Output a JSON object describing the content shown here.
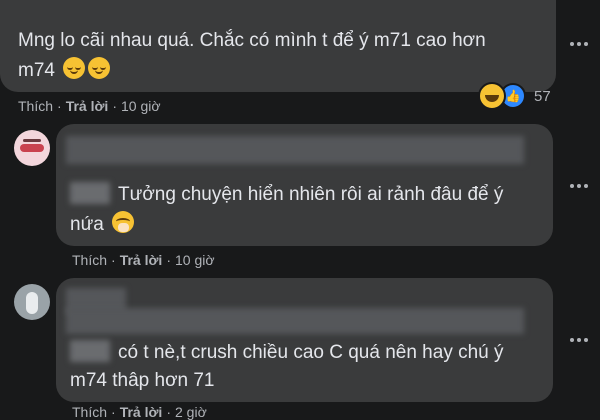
{
  "comments": [
    {
      "text_lines": [
        "Mng lo cãi nhau quá. Chắc có mình t để ý m71 cao hơn",
        "m74"
      ],
      "like_label": "Thích",
      "reply_label": "Trả lời",
      "time": "10 giờ",
      "reaction_count": "57"
    },
    {
      "text_lines": [
        "Tưởng chuyện hiển nhiên rôi ai rảnh đâu để ý",
        "nứa"
      ],
      "like_label": "Thích",
      "reply_label": "Trả lời",
      "time": "10 giờ"
    },
    {
      "text_lines": [
        "có t nè,t crush chiều cao C quá nên hay chú ý",
        "m74 thâp hơn 71"
      ],
      "like_label": "Thích",
      "reply_label": "Trả lời",
      "time": "2 giờ"
    }
  ],
  "icons": [
    "relieved-emoji",
    "haha-reaction",
    "like-reaction",
    "hush-emoji",
    "more-options-icon"
  ],
  "colors": {
    "background": "#18191a",
    "bubble": "#3a3b3c",
    "text": "#e4e6eb",
    "muted": "#b0b3b8",
    "like_blue": "#2d88ff"
  }
}
